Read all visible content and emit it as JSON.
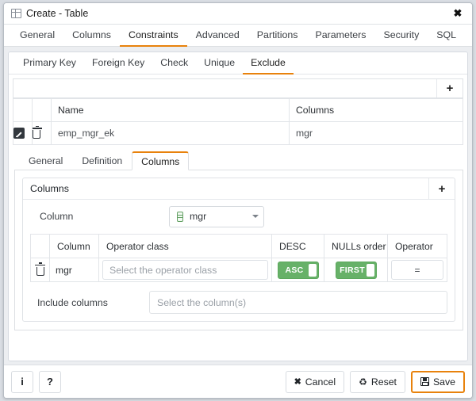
{
  "window": {
    "title": "Create - Table",
    "icon": "table-icon",
    "close_label": "✖"
  },
  "main_tabs": [
    {
      "label": "General",
      "active": false
    },
    {
      "label": "Columns",
      "active": false
    },
    {
      "label": "Constraints",
      "active": true
    },
    {
      "label": "Advanced",
      "active": false
    },
    {
      "label": "Partitions",
      "active": false
    },
    {
      "label": "Parameters",
      "active": false
    },
    {
      "label": "Security",
      "active": false
    },
    {
      "label": "SQL",
      "active": false
    }
  ],
  "sub_tabs": [
    {
      "label": "Primary Key",
      "active": false
    },
    {
      "label": "Foreign Key",
      "active": false
    },
    {
      "label": "Check",
      "active": false
    },
    {
      "label": "Unique",
      "active": false
    },
    {
      "label": "Exclude",
      "active": true
    }
  ],
  "exclude_grid": {
    "add_label": "+",
    "headers": [
      "Name",
      "Columns"
    ],
    "rows": [
      {
        "edit_icon": "edit-icon",
        "delete_icon": "trash-icon",
        "name": "emp_mgr_ek",
        "columns": "mgr"
      }
    ]
  },
  "inner_tabs": [
    {
      "label": "General",
      "active": false
    },
    {
      "label": "Definition",
      "active": false
    },
    {
      "label": "Columns",
      "active": true
    }
  ],
  "columns_panel": {
    "title": "Columns",
    "add_label": "+",
    "column_field": {
      "label": "Column",
      "value": "mgr",
      "icon": "column-icon"
    },
    "table": {
      "headers": [
        "Column",
        "Operator class",
        "DESC",
        "NULLs order",
        "Operator"
      ],
      "rows": [
        {
          "delete_icon": "trash-icon",
          "column": "mgr",
          "operator_class_placeholder": "Select the operator class",
          "desc_toggle": "ASC",
          "nulls_order_toggle": "FIRST",
          "operator": "="
        }
      ]
    },
    "include_columns": {
      "label": "Include columns",
      "placeholder": "Select the column(s)"
    }
  },
  "footer": {
    "info_label": "i",
    "help_label": "?",
    "cancel_label": "Cancel",
    "reset_label": "Reset",
    "save_label": "Save"
  },
  "colors": {
    "accent": "#e8820c",
    "toggle_on": "#67b168",
    "column_icon": "#63a063"
  }
}
